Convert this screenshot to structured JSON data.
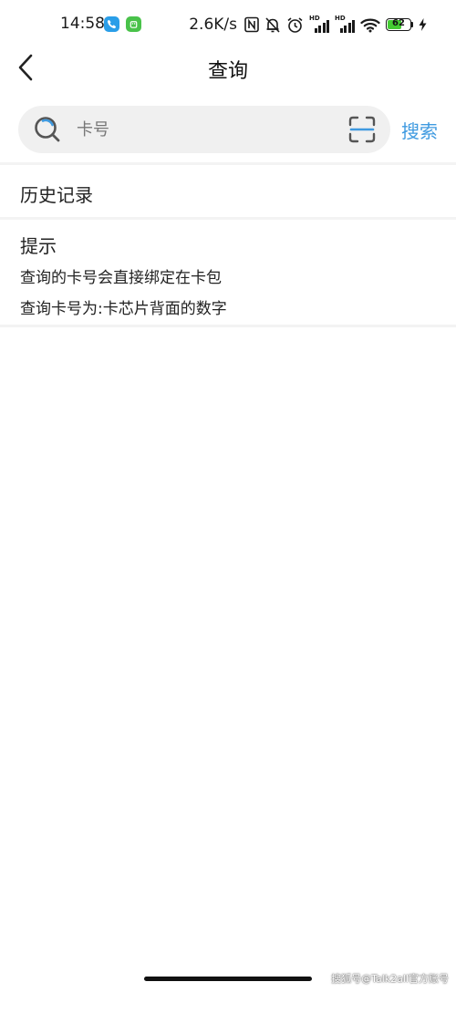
{
  "status_bar": {
    "time": "14:58",
    "net_speed": "2.6K/s",
    "battery_level": "62",
    "battery_fraction": 0.62,
    "signal_1_label": "HD",
    "signal_2_label": "HD",
    "icons": [
      "phone-app-icon",
      "android-app-icon",
      "nfc-icon",
      "mute-icon",
      "alarm-icon",
      "signal-icon",
      "signal-icon",
      "wifi-icon",
      "battery-icon",
      "charging-icon"
    ]
  },
  "nav": {
    "title": "查询",
    "back_icon": "chevron-left-icon"
  },
  "search": {
    "placeholder": "卡号",
    "value": "",
    "button_label": "搜索",
    "scan_icon": "scan-icon",
    "accent_color": "#3f9ae0"
  },
  "history": {
    "title": "历史记录"
  },
  "tips": {
    "title": "提示",
    "lines": [
      "查询的卡号会直接绑定在卡包",
      "查询卡号为:卡芯片背面的数字"
    ]
  },
  "watermark": "搜狐号@Talk2all官方账号"
}
